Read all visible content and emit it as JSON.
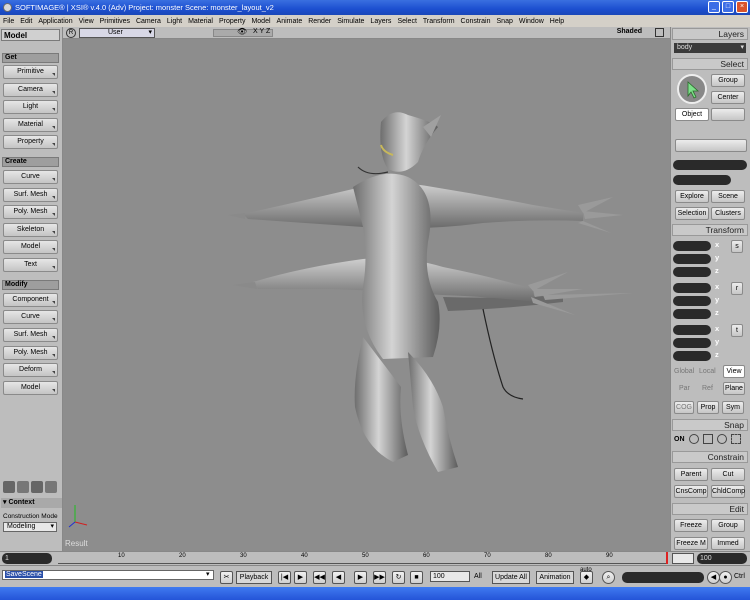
{
  "window": {
    "title": "SOFTIMAGE® | XSI® v.4.0 (Adv) Project: monster    Scene: monster_layout_v2"
  },
  "menu": [
    "File",
    "Edit",
    "Application",
    "View",
    "Primitives",
    "Camera",
    "Light",
    "Material",
    "Property",
    "Model",
    "Animate",
    "Render",
    "Simulate",
    "Layers",
    "Select",
    "Transform",
    "Constrain",
    "Snap",
    "Window",
    "Help"
  ],
  "left": {
    "header": "Model",
    "get": {
      "title": "Get",
      "items": [
        "Primitive",
        "Camera",
        "Light",
        "Material",
        "Property"
      ]
    },
    "create": {
      "title": "Create",
      "items": [
        "Curve",
        "Surf. Mesh",
        "Poly. Mesh",
        "Skeleton",
        "Model",
        "Text"
      ]
    },
    "modify": {
      "title": "Modify",
      "items": [
        "Component",
        "Curve",
        "Surf. Mesh",
        "Poly. Mesh",
        "Deform",
        "Model"
      ]
    },
    "context": "Context",
    "construction_label": "Construction Mode",
    "construction_value": "Modeling"
  },
  "viewport": {
    "camera": "User",
    "shading": "Shaded",
    "label": "Result",
    "xyz": "X Y Z"
  },
  "right": {
    "layers": {
      "title": "Layers",
      "current": "body"
    },
    "select": {
      "title": "Select",
      "group": "Group",
      "center": "Center",
      "object": "Object",
      "explore": "Explore",
      "scene": "Scene",
      "selection": "Selection",
      "clusters": "Clusters"
    },
    "transform": {
      "title": "Transform",
      "axes": [
        "x",
        "y",
        "z",
        "x",
        "y",
        "z",
        "x",
        "y",
        "z"
      ],
      "groups": [
        "s",
        "r",
        "t"
      ],
      "global": "Global",
      "local": "Local",
      "view": "View",
      "par": "Par",
      "ref": "Ref",
      "plane": "Plane",
      "cog": "COG",
      "prop": "Prop",
      "sym": "Sym"
    },
    "snap": {
      "title": "Snap",
      "on": "ON"
    },
    "constrain": {
      "title": "Constrain",
      "parent": "Parent",
      "cut": "Cut",
      "cnscomp": "CnsComp",
      "childcomp": "ChldComp"
    },
    "edit": {
      "title": "Edit",
      "freeze": "Freeze",
      "group": "Group",
      "freezem": "Freeze M",
      "immed": "Immed"
    }
  },
  "timeline": {
    "start": "1",
    "end": "100",
    "ticks": [
      "10",
      "20",
      "30",
      "40",
      "50",
      "60",
      "70",
      "80",
      "90"
    ]
  },
  "bottom": {
    "status": "SaveScene",
    "playback": "Playback",
    "frame": "100",
    "all": "All",
    "update": "Update All",
    "animation": "Animation",
    "auto": "auto",
    "ctrl": "Ctrl"
  }
}
